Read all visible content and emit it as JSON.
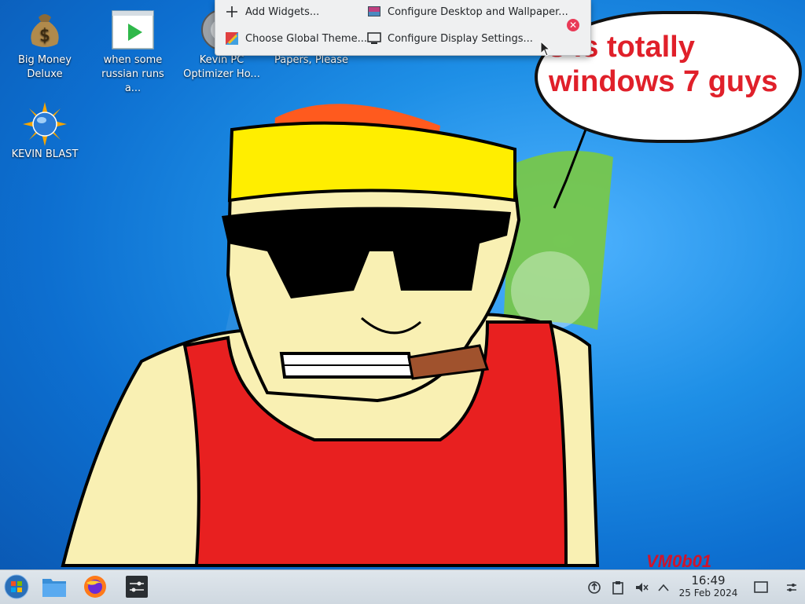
{
  "desktop": {
    "icons": [
      {
        "label": "Big Money Deluxe"
      },
      {
        "label": "when some russian runs a..."
      },
      {
        "label": "Kevin PC Optimizer Ho..."
      },
      {
        "label": "Papers, Please"
      },
      {
        "label": "KEVIN BLAST"
      }
    ]
  },
  "context_menu": {
    "items": [
      {
        "label": "Add Widgets...",
        "icon": "plus-icon"
      },
      {
        "label": "Configure Desktop and Wallpaper...",
        "icon": "wallpaper-icon"
      },
      {
        "label": "Choose Global Theme...",
        "icon": "theme-icon"
      },
      {
        "label": "Configure Display Settings...",
        "icon": "display-icon"
      }
    ],
    "close_icon": "close-icon"
  },
  "wallpaper": {
    "speech_bubble": "s is totally windows 7 guys",
    "speech_line1": "s is totally",
    "speech_line2": "windows 7 guys",
    "signature": "VM0b01"
  },
  "taskbar": {
    "start_icon": "windows-orb-icon",
    "apps": [
      "file-manager-icon",
      "firefox-icon",
      "settings-sliders-icon"
    ],
    "tray": [
      "updates-icon",
      "clipboard-icon",
      "volume-muted-icon",
      "chevron-up-icon"
    ],
    "clock": {
      "time": "16:49",
      "date": "25 Feb 2024"
    },
    "show_desktop_icon": "show-desktop-icon",
    "panel_settings_icon": "panel-settings-icon"
  },
  "colors": {
    "accent": "#1e8fe6",
    "close": "#e93a57",
    "bubble_text": "#e0202a"
  }
}
